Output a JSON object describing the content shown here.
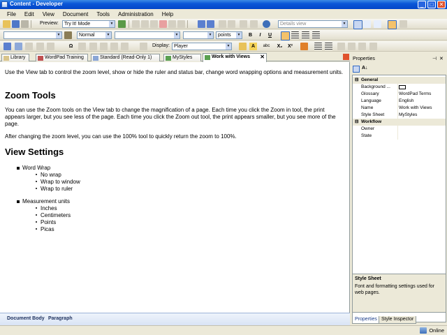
{
  "window": {
    "title": "Content - Developer",
    "minimize": "_",
    "maximize": "□",
    "close": "✕"
  },
  "menu": [
    "File",
    "Edit",
    "View",
    "Document",
    "Tools",
    "Administration",
    "Help"
  ],
  "toolbar1": {
    "preview_label": "Preview:",
    "preview_mode": "Try It! Mode",
    "view_select": "Details view"
  },
  "toolbar2": {
    "style_select": "Normal",
    "units_select": "points",
    "bold": "B",
    "italic": "I",
    "underline": "U"
  },
  "toolbar3": {
    "display_label": "Display:",
    "display_select": "Player",
    "special_char": "Ω",
    "abc": "abc",
    "subscript": "X₂",
    "superscript": "X²"
  },
  "tabs": [
    {
      "label": "Library",
      "active": false
    },
    {
      "label": "WordPad Training",
      "active": false
    },
    {
      "label": "Standard (Read-Only 1)",
      "active": false
    },
    {
      "label": "MyStyles",
      "active": false
    },
    {
      "label": "Work with Views",
      "active": true
    }
  ],
  "document": {
    "intro": "Use the View tab to control the zoom level, show or hide the ruler and status bar, change word wrapping options and measurement units.",
    "h1": "Zoom Tools",
    "p1": "You can use the Zoom tools on the View tab to change the magnification of a page. Each time you click the Zoom in tool, the print appears larger, but you see less of the page. Each time you click the Zoom out tool, the print appears smaller, but you see more of the page.",
    "p2": "After changing the zoom level, you can use the 100% tool to quickly return the zoom to 100%.",
    "h2": "View Settings",
    "list": [
      {
        "label": "Word Wrap",
        "children": [
          "No wrap",
          "Wrap to window",
          "Wrap to ruler"
        ]
      },
      {
        "label": "Measurement units",
        "children": [
          "Inches",
          "Centimeters",
          "Points",
          "Picas"
        ]
      }
    ]
  },
  "doc_status": {
    "left": "Document Body",
    "right": "Paragraph"
  },
  "properties": {
    "title": "Properties",
    "pin": "⊣",
    "close": "✕",
    "categories": [
      {
        "name": "General",
        "rows": [
          {
            "key": "Background ...",
            "value": ""
          },
          {
            "key": "Glossary",
            "value": "WordPad Terms"
          },
          {
            "key": "Language",
            "value": "English"
          },
          {
            "key": "Name",
            "value": "Work with Views"
          },
          {
            "key": "Style Sheet",
            "value": "MyStyles"
          }
        ]
      },
      {
        "name": "Workflow",
        "rows": [
          {
            "key": "Owner",
            "value": ""
          },
          {
            "key": "State",
            "value": ""
          }
        ]
      }
    ],
    "description_title": "Style Sheet",
    "description_body": "Font and formatting settings used for web pages.",
    "bottom_tabs": [
      "Properties",
      "Style Inspector"
    ]
  },
  "app_status": {
    "state": "Online"
  },
  "colors": {
    "title_bar": "#0a57d8",
    "accent": "#316ac5",
    "close": "#e0522d"
  }
}
